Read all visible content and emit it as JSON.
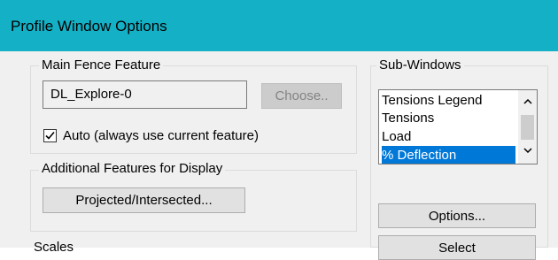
{
  "window": {
    "title": "Profile Window Options"
  },
  "main_fence": {
    "group_label": "Main Fence Feature",
    "feature_value": "DL_Explore-0",
    "choose_label": "Choose..",
    "auto_checked": true,
    "auto_label": "Auto (always use current feature)"
  },
  "additional": {
    "group_label": "Additional Features for Display",
    "projected_label": "Projected/Intersected..."
  },
  "sub_windows": {
    "group_label": "Sub-Windows",
    "items": [
      {
        "label": "Tensions Legend",
        "selected": false
      },
      {
        "label": "Tensions",
        "selected": false
      },
      {
        "label": "Load",
        "selected": false
      },
      {
        "label": "% Deflection",
        "selected": true
      }
    ],
    "options_label": "Options...",
    "select_label": "Select"
  },
  "bottom_partial_label": "Scales"
}
